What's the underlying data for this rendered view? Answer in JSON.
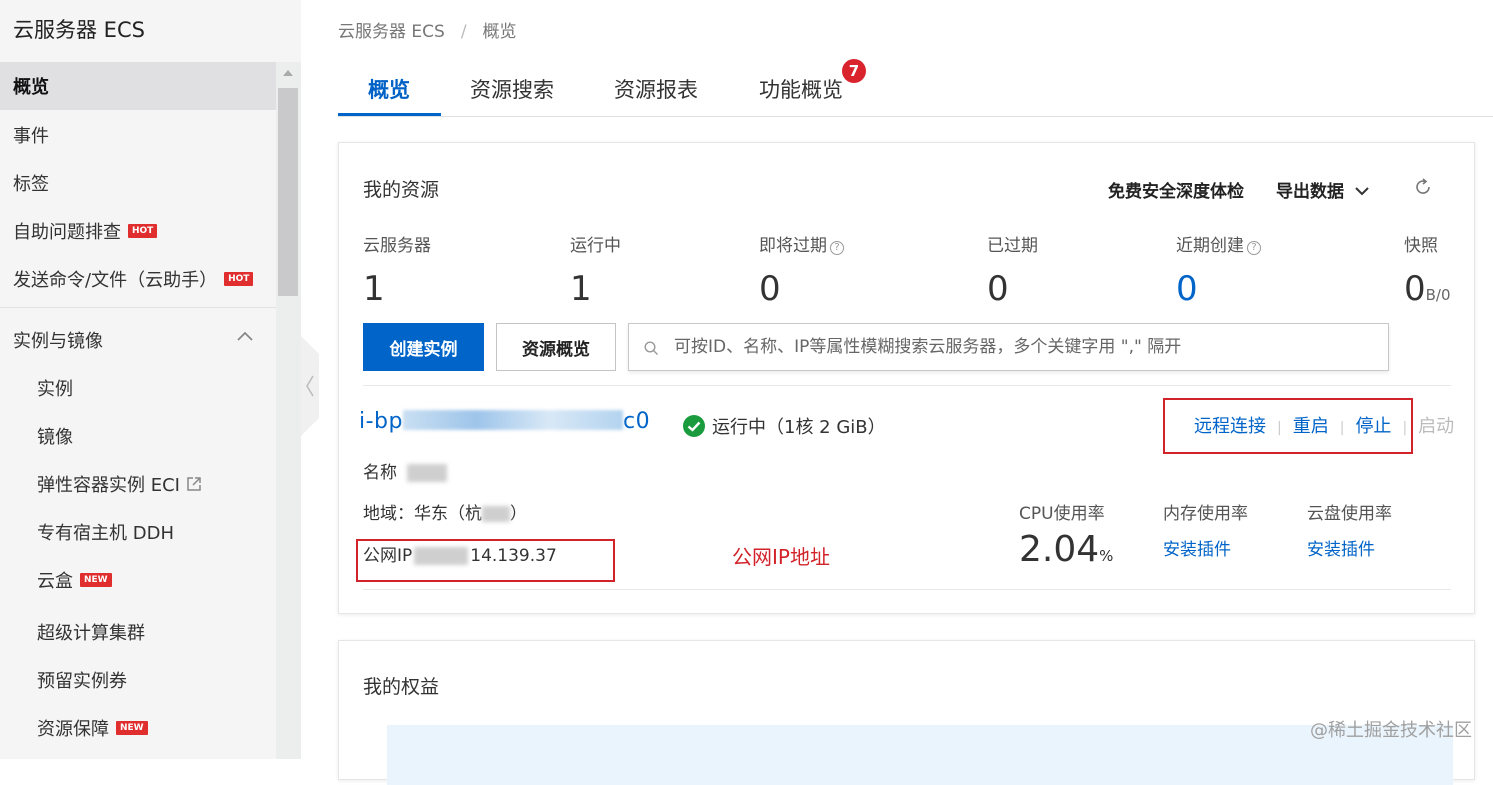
{
  "sidebar": {
    "title": "云服务器 ECS",
    "items": [
      {
        "label": "概览"
      },
      {
        "label": "事件"
      },
      {
        "label": "标签"
      },
      {
        "label": "自助问题排查",
        "badge": "HOT"
      },
      {
        "label": "发送命令/文件（云助手）",
        "badge": "HOT"
      }
    ],
    "group": {
      "label": "实例与镜像",
      "items": [
        {
          "label": "实例"
        },
        {
          "label": "镜像"
        },
        {
          "label": "弹性容器实例 ECI"
        },
        {
          "label": "专有宿主机 DDH"
        },
        {
          "label": "云盒",
          "badge": "NEW"
        },
        {
          "label": "超级计算集群"
        },
        {
          "label": "预留实例券"
        },
        {
          "label": "资源保障",
          "badge": "NEW"
        }
      ]
    }
  },
  "breadcrumb": {
    "root": "云服务器 ECS",
    "sep": "/",
    "current": "概览"
  },
  "tabs": [
    {
      "label": "概览"
    },
    {
      "label": "资源搜索"
    },
    {
      "label": "资源报表"
    },
    {
      "label": "功能概览",
      "badge": "7"
    }
  ],
  "resources": {
    "title": "我的资源",
    "free_check": "免费安全深度体检",
    "export": "导出数据",
    "stats": [
      {
        "label": "云服务器",
        "value": "1"
      },
      {
        "label": "运行中",
        "value": "1"
      },
      {
        "label": "即将过期",
        "value": "0"
      },
      {
        "label": "已过期",
        "value": "0"
      },
      {
        "label": "近期创建",
        "value": "0"
      },
      {
        "label": "快照",
        "value": "0",
        "unit": "B/0"
      }
    ],
    "create_btn": "创建实例",
    "overview_btn": "资源概览",
    "search_placeholder": "可按ID、名称、IP等属性模糊搜索云服务器，多个关键字用 \",\" 隔开"
  },
  "instance": {
    "id_prefix": "i-bp",
    "id_suffix": "c0",
    "status": "运行中（1核 2 GiB）",
    "ops": [
      "远程连接",
      "重启",
      "停止",
      "启动"
    ],
    "name_label": "名称",
    "region_label": "地域：华东",
    "region_mid": "（杭",
    "region_end": "）",
    "ip_label": "公网IP",
    "ip_suffix": "14.139.37",
    "ip_annotation": "公网IP地址",
    "metrics": [
      {
        "label": "CPU使用率",
        "value": "2.04",
        "unit": "%"
      },
      {
        "label": "内存使用率",
        "action": "安装插件"
      },
      {
        "label": "云盘使用率",
        "action": "安装插件"
      }
    ]
  },
  "benefits": {
    "title": "我的权益"
  },
  "watermark": "@稀土掘金技术社区",
  "colors": {
    "accent": "#0064c8",
    "hot": "#e02d2d",
    "annotation": "#d2232a",
    "status_ok": "#1a9c3e"
  }
}
